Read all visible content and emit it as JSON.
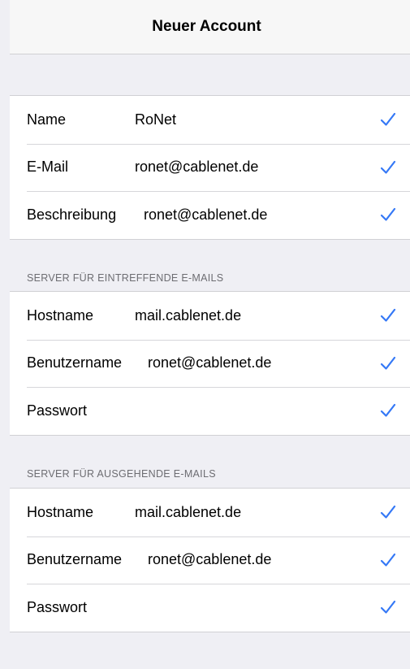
{
  "nav": {
    "title": "Neuer Account"
  },
  "account": {
    "rows": [
      {
        "label": "Name",
        "value": "RoNet"
      },
      {
        "label": "E-Mail",
        "value": "ronet@cablenet.de"
      },
      {
        "label": "Beschreibung",
        "value": "ronet@cablenet.de"
      }
    ]
  },
  "incoming": {
    "header": "SERVER FÜR EINTREFFENDE E-MAILS",
    "rows": [
      {
        "label": "Hostname",
        "value": "mail.cablenet.de"
      },
      {
        "label": "Benutzername",
        "value": "ronet@cablenet.de"
      },
      {
        "label": "Passwort",
        "value": ""
      }
    ]
  },
  "outgoing": {
    "header": "SERVER FÜR AUSGEHENDE E-MAILS",
    "rows": [
      {
        "label": "Hostname",
        "value": "mail.cablenet.de"
      },
      {
        "label": "Benutzername",
        "value": "ronet@cablenet.de"
      },
      {
        "label": "Passwort",
        "value": ""
      }
    ]
  },
  "colors": {
    "accent": "#3478f6",
    "background": "#efeff4",
    "separator": "#d6d6da"
  },
  "icons": {
    "row_status": "checkmark-icon"
  }
}
